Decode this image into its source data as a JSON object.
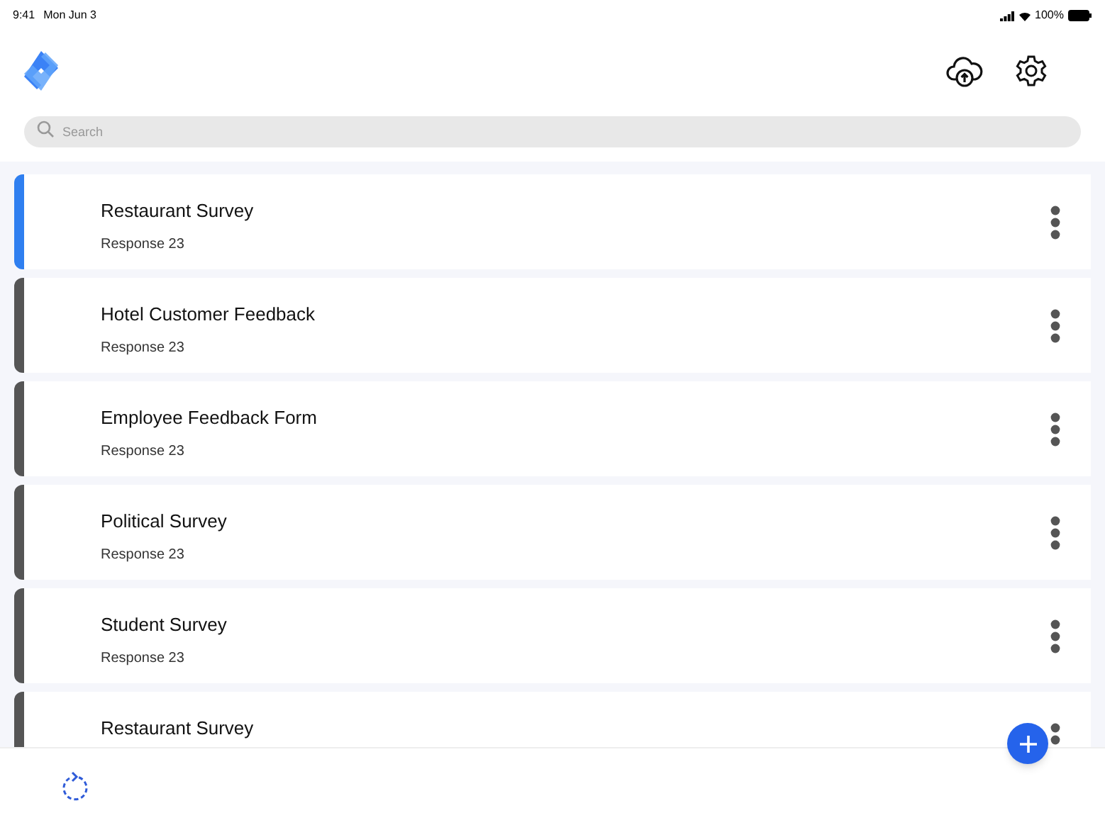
{
  "status_bar": {
    "time": "9:41",
    "date": "Mon Jun 3",
    "battery": "100%"
  },
  "search": {
    "placeholder": "Search"
  },
  "surveys": [
    {
      "title": "Restaurant Survey",
      "subtitle": "Response 23",
      "selected": true
    },
    {
      "title": "Hotel Customer Feedback",
      "subtitle": "Response 23",
      "selected": false
    },
    {
      "title": "Employee Feedback Form",
      "subtitle": "Response 23",
      "selected": false
    },
    {
      "title": "Political Survey",
      "subtitle": "Response 23",
      "selected": false
    },
    {
      "title": "Student Survey",
      "subtitle": "Response 23",
      "selected": false
    },
    {
      "title": "Restaurant Survey",
      "selected": false
    }
  ]
}
